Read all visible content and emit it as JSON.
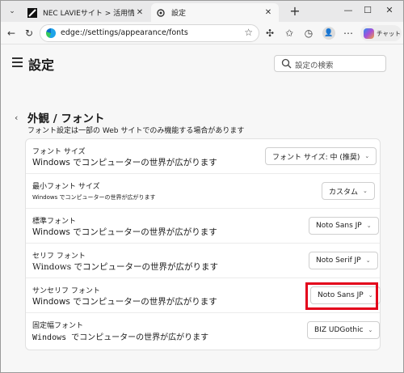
{
  "browser": {
    "tabs": [
      {
        "title": "NEC LAVIEサイト > 活用情報 >"
      },
      {
        "title": "設定"
      }
    ],
    "address_url": "edge://settings/appearance/fonts",
    "copilot_label": "チャット"
  },
  "settings": {
    "title": "設定",
    "search_placeholder": "設定の検索",
    "section_title": "外観 / フォント",
    "section_subtitle": "フォント設定は一部の Web サイトでのみ機能する場合があります",
    "rows": [
      {
        "label": "フォント サイズ",
        "sample": "Windows でコンピューターの世界が広がります",
        "value": "フォント サイズ: 中 (推奨)"
      },
      {
        "label": "最小フォント サイズ",
        "sample": "Windows でコンピューターの世界が広がります",
        "value": "カスタム"
      },
      {
        "label": "標準フォント",
        "sample": "Windows でコンピューターの世界が広がります",
        "value": "Noto Sans JP"
      },
      {
        "label": "セリフ フォント",
        "sample": "Windows でコンピューターの世界が広がります",
        "value": "Noto Serif JP"
      },
      {
        "label": "サンセリフ フォント",
        "sample": "Windows でコンピューターの世界が広がります",
        "value": "Noto Sans JP"
      },
      {
        "label": "固定幅フォント",
        "sample": "Windows でコンピューターの世界が広がります",
        "value": "BIZ UDGothic"
      }
    ]
  },
  "colors": {
    "highlight": "#e3001b",
    "accent": "#0b6fc9"
  }
}
